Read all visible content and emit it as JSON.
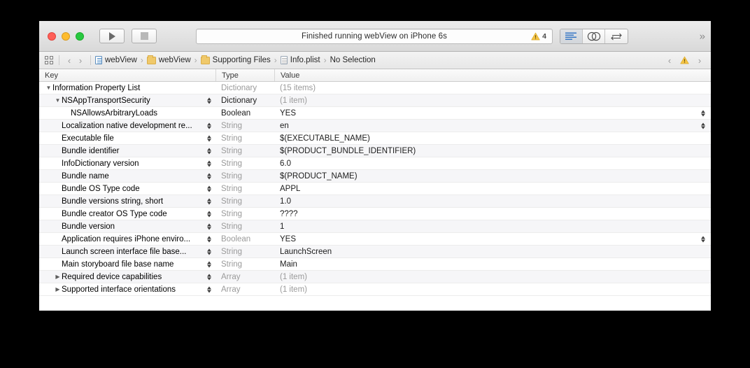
{
  "window": {
    "traffic_lights": [
      "close",
      "minimize",
      "zoom"
    ]
  },
  "toolbar": {
    "run_label": "Run",
    "stop_label": "Stop",
    "status_text": "Finished running webView on iPhone 6s",
    "warning_count": "4",
    "warning_icon": "warning-triangle-icon",
    "editor_segments": [
      {
        "name": "standard-editor",
        "icon": "lines-icon",
        "active": true
      },
      {
        "name": "assistant-editor",
        "icon": "venn-circles-icon",
        "active": false
      },
      {
        "name": "version-editor",
        "icon": "arrows-swap-icon",
        "active": false
      }
    ],
    "overflow_label": "»"
  },
  "breadcrumb": {
    "grid_icon": "grid-icon",
    "back_arrow": "‹",
    "forward_arrow": "›",
    "separator": "›",
    "items": [
      {
        "label": "webView",
        "icon": "project-document-icon"
      },
      {
        "label": "webView",
        "icon": "folder-icon"
      },
      {
        "label": "Supporting Files",
        "icon": "folder-icon"
      },
      {
        "label": "Info.plist",
        "icon": "plist-document-icon"
      },
      {
        "label": "No Selection",
        "icon": "none"
      }
    ],
    "right_prev": "‹",
    "right_warning_icon": "warning-triangle-icon",
    "right_next": "›"
  },
  "table": {
    "columns": [
      "Key",
      "Type",
      "Value"
    ],
    "rows": [
      {
        "key": "Information Property List",
        "type": "Dictionary",
        "value": "(15 items)",
        "indent": 0,
        "disclosure": "expanded",
        "stepper": false,
        "value_stepper": false,
        "type_muted": true,
        "value_muted": true
      },
      {
        "key": "NSAppTransportSecurity",
        "type": "Dictionary",
        "value": "(1 item)",
        "indent": 1,
        "disclosure": "expanded",
        "stepper": true,
        "value_stepper": false,
        "type_muted": false,
        "value_muted": true
      },
      {
        "key": "NSAllowsArbitraryLoads",
        "type": "Boolean",
        "value": "YES",
        "indent": 2,
        "disclosure": "none",
        "stepper": false,
        "value_stepper": true,
        "type_muted": false,
        "value_muted": false
      },
      {
        "key": "Localization native development re...",
        "type": "String",
        "value": "en",
        "indent": 1,
        "disclosure": "none",
        "stepper": true,
        "value_stepper": true,
        "type_muted": true,
        "value_muted": false
      },
      {
        "key": "Executable file",
        "type": "String",
        "value": "$(EXECUTABLE_NAME)",
        "indent": 1,
        "disclosure": "none",
        "stepper": true,
        "value_stepper": false,
        "type_muted": true,
        "value_muted": false
      },
      {
        "key": "Bundle identifier",
        "type": "String",
        "value": "$(PRODUCT_BUNDLE_IDENTIFIER)",
        "indent": 1,
        "disclosure": "none",
        "stepper": true,
        "value_stepper": false,
        "type_muted": true,
        "value_muted": false
      },
      {
        "key": "InfoDictionary version",
        "type": "String",
        "value": "6.0",
        "indent": 1,
        "disclosure": "none",
        "stepper": true,
        "value_stepper": false,
        "type_muted": true,
        "value_muted": false
      },
      {
        "key": "Bundle name",
        "type": "String",
        "value": "$(PRODUCT_NAME)",
        "indent": 1,
        "disclosure": "none",
        "stepper": true,
        "value_stepper": false,
        "type_muted": true,
        "value_muted": false
      },
      {
        "key": "Bundle OS Type code",
        "type": "String",
        "value": "APPL",
        "indent": 1,
        "disclosure": "none",
        "stepper": true,
        "value_stepper": false,
        "type_muted": true,
        "value_muted": false
      },
      {
        "key": "Bundle versions string, short",
        "type": "String",
        "value": "1.0",
        "indent": 1,
        "disclosure": "none",
        "stepper": true,
        "value_stepper": false,
        "type_muted": true,
        "value_muted": false
      },
      {
        "key": "Bundle creator OS Type code",
        "type": "String",
        "value": "????",
        "indent": 1,
        "disclosure": "none",
        "stepper": true,
        "value_stepper": false,
        "type_muted": true,
        "value_muted": false
      },
      {
        "key": "Bundle version",
        "type": "String",
        "value": "1",
        "indent": 1,
        "disclosure": "none",
        "stepper": true,
        "value_stepper": false,
        "type_muted": true,
        "value_muted": false
      },
      {
        "key": "Application requires iPhone enviro...",
        "type": "Boolean",
        "value": "YES",
        "indent": 1,
        "disclosure": "none",
        "stepper": true,
        "value_stepper": true,
        "type_muted": true,
        "value_muted": false
      },
      {
        "key": "Launch screen interface file base...",
        "type": "String",
        "value": "LaunchScreen",
        "indent": 1,
        "disclosure": "none",
        "stepper": true,
        "value_stepper": false,
        "type_muted": true,
        "value_muted": false
      },
      {
        "key": "Main storyboard file base name",
        "type": "String",
        "value": "Main",
        "indent": 1,
        "disclosure": "none",
        "stepper": true,
        "value_stepper": false,
        "type_muted": true,
        "value_muted": false
      },
      {
        "key": "Required device capabilities",
        "type": "Array",
        "value": "(1 item)",
        "indent": 1,
        "disclosure": "collapsed",
        "stepper": true,
        "value_stepper": false,
        "type_muted": true,
        "value_muted": true
      },
      {
        "key": "Supported interface orientations",
        "type": "Array",
        "value": "(1 item)",
        "indent": 1,
        "disclosure": "collapsed",
        "stepper": true,
        "value_stepper": false,
        "type_muted": true,
        "value_muted": true
      }
    ]
  }
}
